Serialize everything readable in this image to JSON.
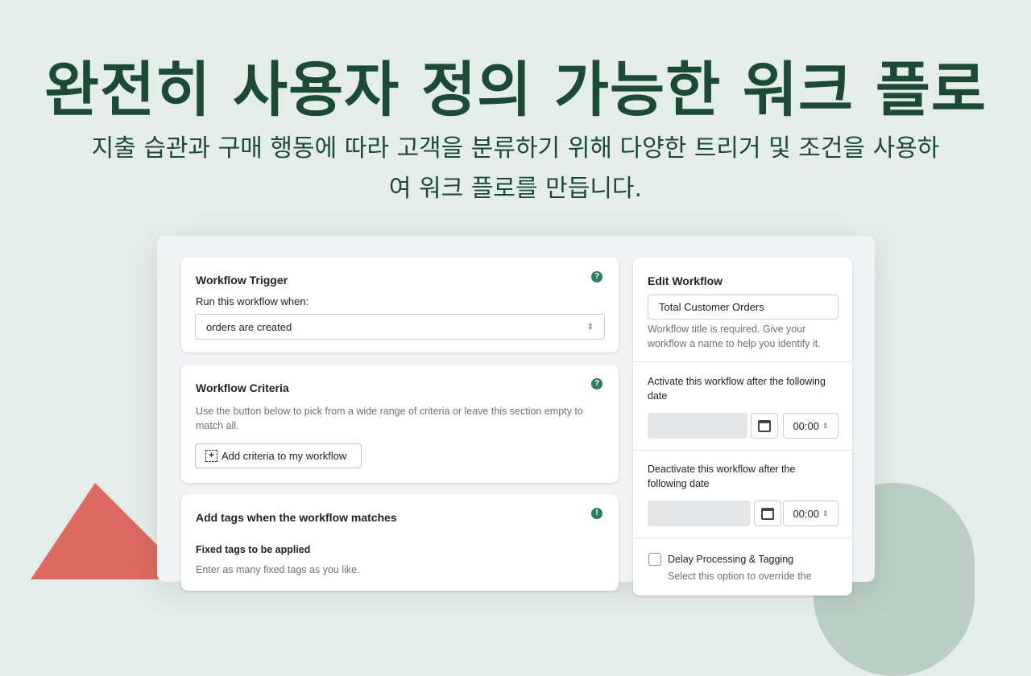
{
  "hero": {
    "title": "완전히 사용자 정의 가능한 워크 플로",
    "subtitle": "지출 습관과 구매 행동에 따라 고객을 분류하기 위해 다양한 트리거 및 조건을 사용하여 워크 플로를 만듭니다."
  },
  "colors": {
    "background": "#e4ede9",
    "title": "#1d4a37",
    "accent": "#2e7d5b",
    "triangle": "#dc6a5e",
    "circle": "#b9cfc5"
  },
  "trigger": {
    "title": "Workflow Trigger",
    "label": "Run this workflow when:",
    "value": "orders are created",
    "help_icon": "?"
  },
  "criteria": {
    "title": "Workflow Criteria",
    "description": "Use the button below to pick from a wide range of criteria or leave this section empty to match all.",
    "button": "Add criteria to my workflow",
    "help_icon": "?"
  },
  "tags": {
    "title": "Add tags when the workflow matches",
    "subtitle": "Fixed tags to be applied",
    "description": "Enter as many fixed tags as you like.",
    "alert_icon": "!"
  },
  "edit": {
    "title": "Edit Workflow",
    "name_value": "Total Customer Orders",
    "name_help": "Workflow title is required. Give your workflow a name to help you identify it.",
    "activate_label": "Activate this workflow after the following date",
    "activate_time": "00:00",
    "deactivate_label": "Deactivate this workflow after the following date",
    "deactivate_time": "00:00",
    "delay_label": "Delay Processing & Tagging",
    "delay_help": "Select this option to override the"
  }
}
